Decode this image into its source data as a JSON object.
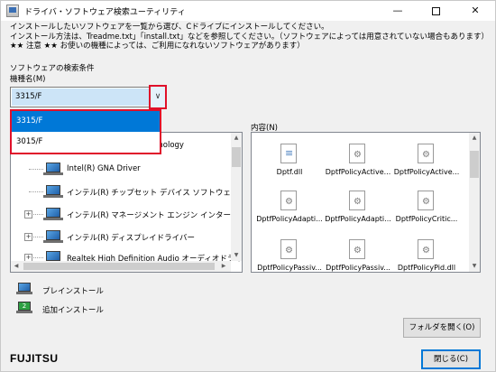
{
  "window": {
    "title": "ドライバ・ソフトウェア検索ユーティリティ"
  },
  "instructions": [
    "インストールしたいソフトウェアを一覧から選び、Cドライブにインストールしてください。",
    "インストール方法は、Treadme.txt」「install.txt」などを参照してください。（ソフトウェアによっては用意されていない場合もあります）",
    "★★ 注意 ★★ お使いの機種によっては、ご利用になれないソフトウェアがあります）"
  ],
  "search": {
    "section_label": "ソフトウェアの検索条件",
    "model_label": "機種名(M)",
    "model_value": "3315/F",
    "model_options": [
      "3315/F",
      "3015/F"
    ]
  },
  "tree": {
    "items": [
      {
        "label": "Intel(R) GNA Driver",
        "expandable": false
      },
      {
        "label": "インテル(R) チップセット デバイス ソフトウェア",
        "expandable": false
      },
      {
        "label": "インテル(R) マネージメント エンジン インターフェイ",
        "expandable": true
      },
      {
        "label": "インテル(R) ディスプレイドライバー",
        "expandable": true
      },
      {
        "label": "Realtek High Definition Audio オーディオドライバ",
        "expandable": true
      }
    ],
    "partial_top_label": "hnology"
  },
  "contents": {
    "label": "内容(N)",
    "files": [
      "Dptf.dll",
      "DptfPolicyActive...",
      "DptfPolicyActive...",
      "DptfPolicyAdapti...",
      "DptfPolicyAdapti...",
      "DptfPolicyCritic...",
      "DptfPolicyPassiv...",
      "DptfPolicyPassiv...",
      "DptfPolicyPid.dll"
    ]
  },
  "legend": {
    "preinstall": "プレインストール",
    "additional": "追加インストール",
    "additional_badge": "2"
  },
  "buttons": {
    "open_folder": "フォルダを開く(O)",
    "close": "閉じる(C)"
  },
  "brand": {
    "logo": "FUJITSU"
  }
}
